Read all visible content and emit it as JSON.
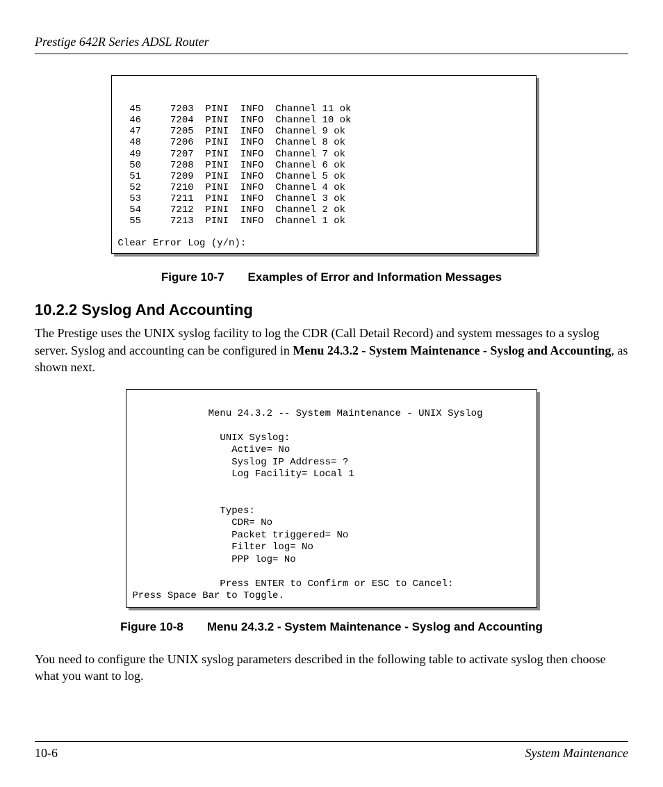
{
  "header": {
    "title": "Prestige 642R Series ADSL Router"
  },
  "figure1": {
    "rows": [
      [
        "45",
        "7203",
        "PINI",
        "INFO",
        "Channel 11 ok"
      ],
      [
        "46",
        "7204",
        "PINI",
        "INFO",
        "Channel 10 ok"
      ],
      [
        "47",
        "7205",
        "PINI",
        "INFO",
        "Channel 9 ok"
      ],
      [
        "48",
        "7206",
        "PINI",
        "INFO",
        "Channel 8 ok"
      ],
      [
        "49",
        "7207",
        "PINI",
        "INFO",
        "Channel 7 ok"
      ],
      [
        "50",
        "7208",
        "PINI",
        "INFO",
        "Channel 6 ok"
      ],
      [
        "51",
        "7209",
        "PINI",
        "INFO",
        "Channel 5 ok"
      ],
      [
        "52",
        "7210",
        "PINI",
        "INFO",
        "Channel 4 ok"
      ],
      [
        "53",
        "7211",
        "PINI",
        "INFO",
        "Channel 3 ok"
      ],
      [
        "54",
        "7212",
        "PINI",
        "INFO",
        "Channel 2 ok"
      ],
      [
        "55",
        "7213",
        "PINI",
        "INFO",
        "Channel 1 ok"
      ]
    ],
    "prompt": "Clear Error Log (y/n):",
    "caption": "Figure 10-7  Examples of Error and Information Messages"
  },
  "section": {
    "heading": "10.2.2 Syslog And Accounting",
    "para1_pre": "The Prestige uses the UNIX syslog facility to log the CDR (Call Detail Record) and system messages to a syslog server. Syslog and accounting can be configured in ",
    "para1_bold": "Menu 24.3.2 - System Maintenance - Syslog and Accounting",
    "para1_post": ", as shown next."
  },
  "figure2": {
    "title": "Menu 24.3.2 -- System Maintenance - UNIX Syslog",
    "group1_label": "UNIX Syslog:",
    "group1_lines": [
      "Active= No",
      "Syslog IP Address= ?",
      "Log Facility= Local 1"
    ],
    "group2_label": "Types:",
    "group2_lines": [
      "CDR= No",
      "Packet triggered= No",
      "Filter log= No",
      "PPP log= No"
    ],
    "confirm_line": "Press ENTER to Confirm or ESC to Cancel:",
    "toggle_line": "Press Space Bar to Toggle.",
    "caption": "Figure 10-8  Menu 24.3.2 - System Maintenance - Syslog and Accounting"
  },
  "para2": "You need to configure the UNIX syslog parameters described in the following table to activate syslog then choose what you want to log.",
  "footer": {
    "page_num": "10-6",
    "section": "System Maintenance"
  }
}
